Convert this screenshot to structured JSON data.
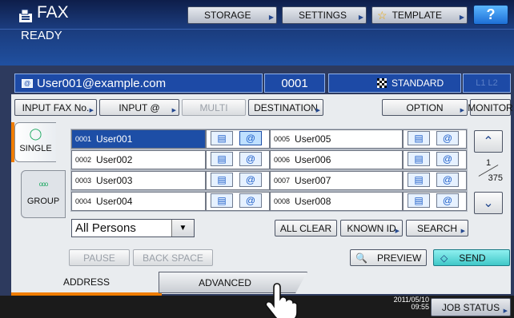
{
  "header": {
    "title": "FAX",
    "status": "READY",
    "buttons": {
      "storage": "STORAGE",
      "settings": "SETTINGS",
      "template": "TEMPLATE",
      "help": "?"
    }
  },
  "info": {
    "user": "User001@example.com",
    "count": "0001",
    "mode": "STANDARD",
    "lines": "L1 L2"
  },
  "toolbar": {
    "input_fax": "INPUT FAX No.",
    "input_at": "INPUT @",
    "multi": "MULTI",
    "destination": "DESTINATION",
    "option": "OPTION",
    "monitor": "MONITOR"
  },
  "tabs": {
    "single": "SINGLE",
    "group": "GROUP"
  },
  "entries": [
    {
      "num": "0001",
      "name": "User001"
    },
    {
      "num": "0005",
      "name": "User005"
    },
    {
      "num": "0002",
      "name": "User002"
    },
    {
      "num": "0006",
      "name": "User006"
    },
    {
      "num": "0003",
      "name": "User003"
    },
    {
      "num": "0007",
      "name": "User007"
    },
    {
      "num": "0004",
      "name": "User004"
    },
    {
      "num": "0008",
      "name": "User008"
    }
  ],
  "paging": {
    "current": "1",
    "total": "375"
  },
  "filter": {
    "selected": "All Persons"
  },
  "actions": {
    "all_clear": "ALL CLEAR",
    "known_id": "KNOWN ID",
    "search": "SEARCH",
    "pause": "PAUSE",
    "back_space": "BACK SPACE",
    "preview": "PREVIEW",
    "send": "SEND"
  },
  "bottom_tabs": {
    "address": "ADDRESS",
    "advanced": "ADVANCED"
  },
  "footer": {
    "date": "2011/05/10",
    "time": "09:55",
    "job_status": "JOB STATUS"
  },
  "colors": {
    "accent": "#f07d00",
    "header_blue": "#1d4aa6",
    "send_teal": "#3fc8c8"
  }
}
